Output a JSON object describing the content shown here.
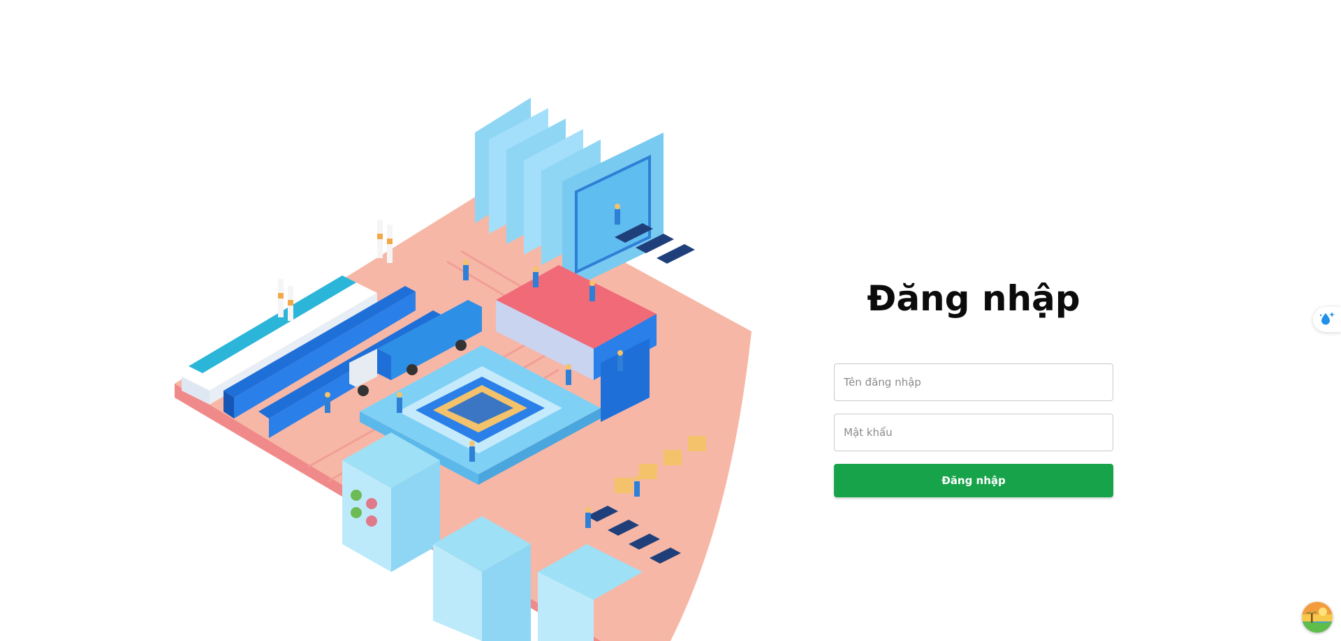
{
  "login": {
    "title": "Đăng nhập",
    "username_placeholder": "Tên đăng nhập",
    "password_placeholder": "Mật khẩu",
    "submit_label": "Đăng nhập"
  },
  "colors": {
    "primary_button": "#16a34a",
    "title_text": "#0b0b0b"
  },
  "icons": {
    "side_widget": "water-drop-sparkle-icon",
    "corner_avatar": "beach-landscape-avatar-icon"
  },
  "illustration": {
    "subject": "isometric-factory-circuit-board"
  }
}
